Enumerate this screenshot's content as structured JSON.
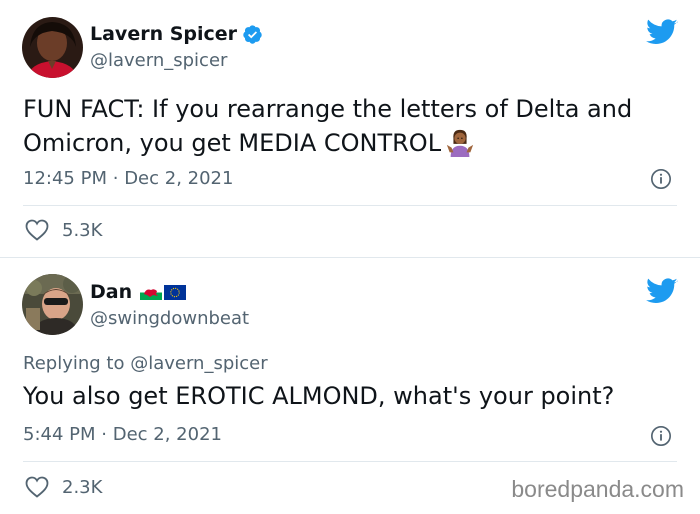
{
  "tweets": [
    {
      "display_name": "Lavern Spicer",
      "verified": true,
      "handle": "@lavern_spicer",
      "text": "FUN FACT: If you rearrange the letters of Delta and Omicron, you get MEDIA CONTROL",
      "emoji": "woman-shrugging",
      "time": "12:45 PM",
      "dot": "·",
      "date": "Dec 2, 2021",
      "likes": "5.3K"
    },
    {
      "display_name": "Dan",
      "flags": [
        "wales-flag",
        "eu-flag"
      ],
      "handle": "@swingdownbeat",
      "reply_prefix": "Replying to",
      "reply_to": "@lavern_spicer",
      "text": "You also get EROTIC ALMOND, what's your point?",
      "time": "5:44 PM",
      "dot": "·",
      "date": "Dec 2, 2021",
      "likes": "2.3K"
    }
  ],
  "watermark": "boredpanda.com",
  "colors": {
    "twitter_blue": "#1d9bf0",
    "text": "#0f1419",
    "secondary": "#536471",
    "border": "#e1e8ed"
  }
}
